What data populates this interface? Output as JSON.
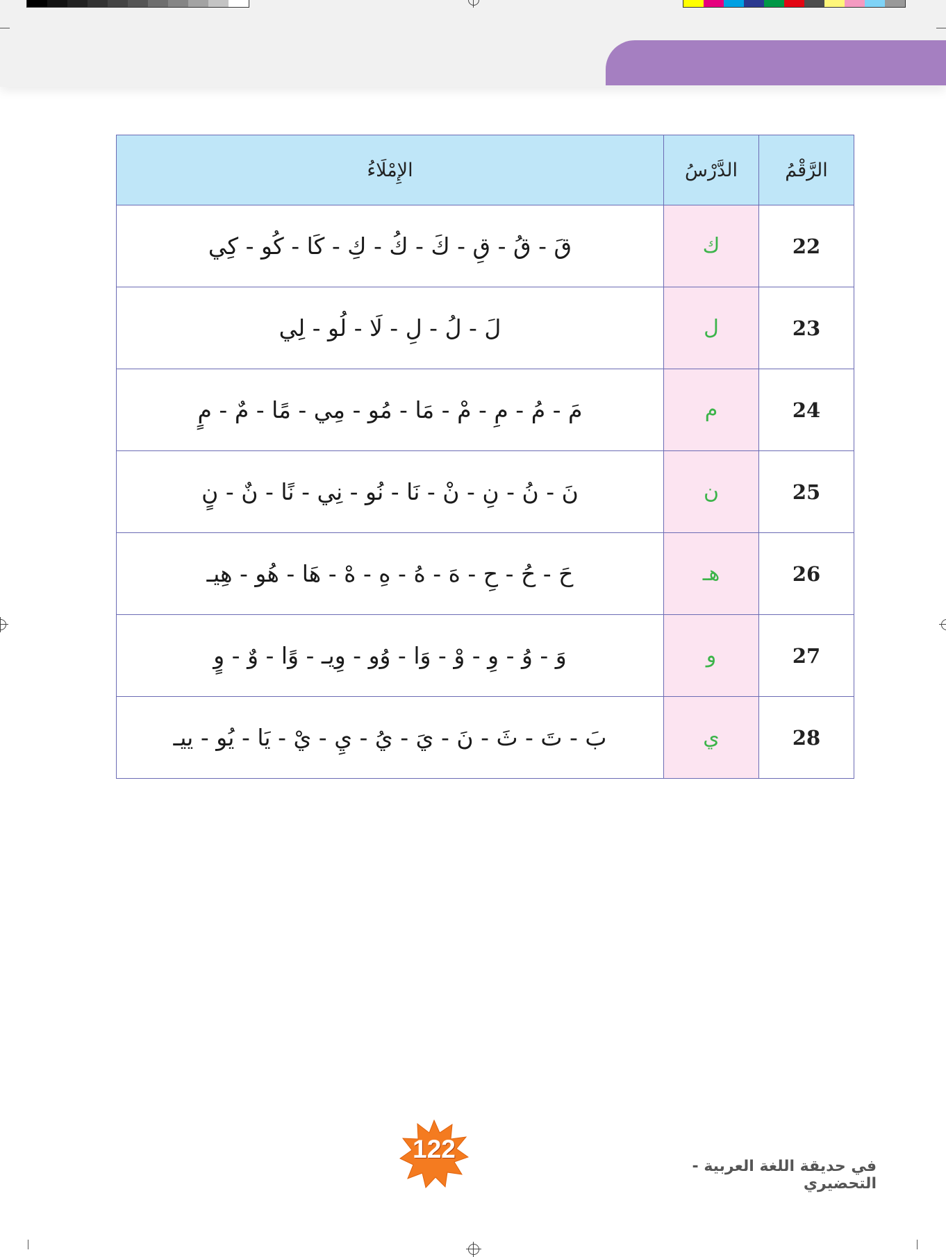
{
  "print_marks": {
    "grays": [
      "#000000",
      "#121212",
      "#222222",
      "#333333",
      "#444444",
      "#555555",
      "#6e6e6e",
      "#858585",
      "#a3a3a3",
      "#c4c4c4",
      "#ffffff"
    ],
    "colors": [
      "#ffff00",
      "#e6007e",
      "#00a0e3",
      "#2b3990",
      "#009846",
      "#e30613",
      "#4d4d4d",
      "#fff67a",
      "#f49ac1",
      "#7fd3f7",
      "#999999"
    ]
  },
  "header": {
    "tab_color": "#a57fc1"
  },
  "table": {
    "headers": {
      "number": "الرَّقْمُ",
      "lesson": "الدَّرْسُ",
      "dictation": "الإِمْلَاءُ"
    },
    "rows": [
      {
        "number": "22",
        "lesson": "ك",
        "dictation": "قَ - قُ - قِ - كَ - كُ - كِ - كَا - كُو - كِي"
      },
      {
        "number": "23",
        "lesson": "ل",
        "dictation": "لَ - لُ - لِ - لَا - لُو - لِي"
      },
      {
        "number": "24",
        "lesson": "م",
        "dictation": "مَ - مُ - مِ - مْ - مَا - مُو - مِي - مًا - مٌ - مٍ"
      },
      {
        "number": "25",
        "lesson": "ن",
        "dictation": "نَ - نُ - نِ - نْ - نَا - نُو - نِي - نًا - نٌ - نٍ"
      },
      {
        "number": "26",
        "lesson": "هـ",
        "dictation": "حَ - حُ - حِ - هَ - هُ - هِ - هْ - هَا - هُو - هِيـ"
      },
      {
        "number": "27",
        "lesson": "و",
        "dictation": "وَ - وُ - وِ - وْ - وَا - وُو - وِيـ - وًا - وٌ - وٍ"
      },
      {
        "number": "28",
        "lesson": "ي",
        "dictation": "بَ - تَ - ثَ - نَ - يَ - يُ - يِ - يْ - يَا - يُو - ييـ"
      }
    ],
    "header_color": "#bfe6f8",
    "lesson_bg": "#fce4f1",
    "lesson_text_color": "#3cb44a"
  },
  "footer": {
    "page_number": "122",
    "book_title": "في حديقة اللغة العربية - التحضيري",
    "star_color": "#f47b20"
  }
}
